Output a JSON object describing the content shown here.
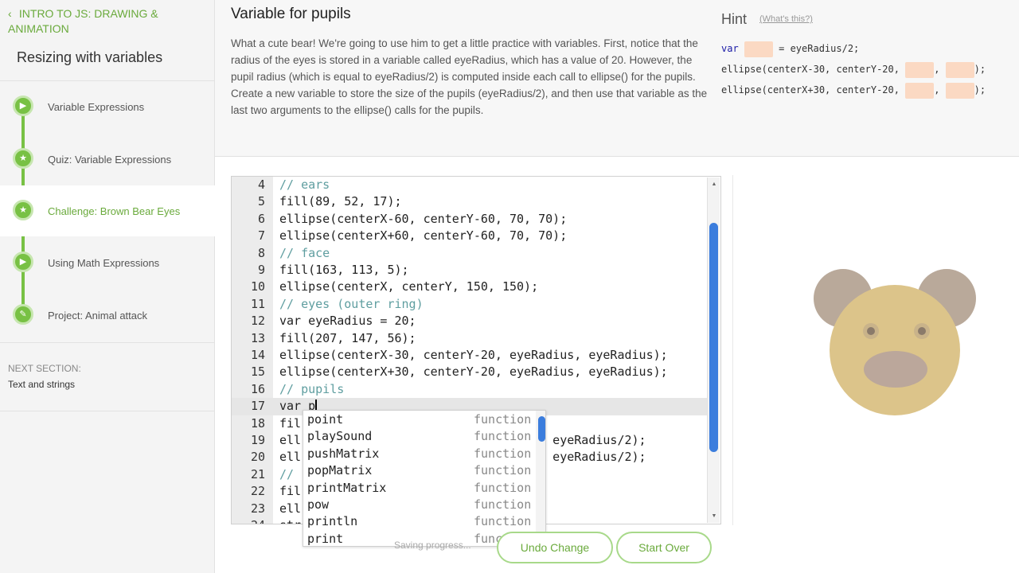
{
  "sidebar": {
    "breadcrumb": "INTRO TO JS: DRAWING & ANIMATION",
    "lesson_title": "Resizing with variables",
    "items": [
      {
        "label": "Variable Expressions",
        "icon": "play-icon"
      },
      {
        "label": "Quiz: Variable Expressions",
        "icon": "star-icon"
      },
      {
        "label": "Challenge: Brown Bear Eyes",
        "icon": "star-icon",
        "active": true
      },
      {
        "label": "Using Math Expressions",
        "icon": "play-icon"
      },
      {
        "label": "Project: Animal attack",
        "icon": "pencil-icon"
      }
    ],
    "next_label": "NEXT SECTION:",
    "next_title": "Text and strings"
  },
  "challenge": {
    "title": "Variable for pupils",
    "description": "What a cute bear! We're going to use him to get a little practice with variables. First, notice that the radius of the eyes is stored in a variable called eyeRadius, which has a value of 20. However, the pupil radius (which is equal to eyeRadius/2) is computed inside each call to ellipse() for the pupils. Create a new variable to store the size of the pupils (eyeRadius/2), and then use that variable as the last two arguments to the ellipse() calls for the pupils."
  },
  "hint": {
    "title": "Hint",
    "help_link": "(What's this?)",
    "line1_a": "var ",
    "line1_b": " = eyeRadius/2;",
    "line2_a": "ellipse(centerX-30, centerY-20, ",
    "line2_sep": ", ",
    "line2_end": ");",
    "line3_a": "ellipse(centerX+30, centerY-20, ",
    "line3_sep": ", ",
    "line3_end": ");"
  },
  "editor": {
    "lines": [
      {
        "n": "4",
        "text": "// ears"
      },
      {
        "n": "5",
        "text": "fill(89, 52, 17);"
      },
      {
        "n": "6",
        "text": "ellipse(centerX-60, centerY-60, 70, 70);"
      },
      {
        "n": "7",
        "text": "ellipse(centerX+60, centerY-60, 70, 70);"
      },
      {
        "n": "8",
        "text": "// face"
      },
      {
        "n": "9",
        "text": "fill(163, 113, 5);"
      },
      {
        "n": "10",
        "text": "ellipse(centerX, centerY, 150, 150);"
      },
      {
        "n": "11",
        "text": "// eyes (outer ring)"
      },
      {
        "n": "12",
        "text": "var eyeRadius = 20;"
      },
      {
        "n": "13",
        "text": "fill(207, 147, 56);"
      },
      {
        "n": "14",
        "text": "ellipse(centerX-30, centerY-20, eyeRadius, eyeRadius);"
      },
      {
        "n": "15",
        "text": "ellipse(centerX+30, centerY-20, eyeRadius, eyeRadius);"
      },
      {
        "n": "16",
        "text": "// pupils"
      },
      {
        "n": "17",
        "text": "var p",
        "current": true
      },
      {
        "n": "18",
        "text": "fil"
      },
      {
        "n": "19",
        "text": "ell                           dius/2, eyeRadius/2);"
      },
      {
        "n": "20",
        "text": "ell                           dius/2, eyeRadius/2);"
      },
      {
        "n": "21",
        "text": "// "
      },
      {
        "n": "22",
        "text": "fil"
      },
      {
        "n": "23",
        "text": "ell"
      },
      {
        "n": "24",
        "text": "str"
      }
    ]
  },
  "autocomplete": {
    "items": [
      {
        "name": "point",
        "type": "function"
      },
      {
        "name": "playSound",
        "type": "function"
      },
      {
        "name": "pushMatrix",
        "type": "function"
      },
      {
        "name": "popMatrix",
        "type": "function"
      },
      {
        "name": "printMatrix",
        "type": "function"
      },
      {
        "name": "pow",
        "type": "function"
      },
      {
        "name": "println",
        "type": "function"
      },
      {
        "name": "print",
        "type": "function"
      }
    ]
  },
  "controls": {
    "saving": "Saving progress...",
    "undo": "Undo Change",
    "start_over": "Start Over"
  },
  "colors": {
    "accent_green": "#6aaa3c",
    "hint_blank": "#fbd9c3",
    "scroll_blue": "#3b7ddd",
    "bear_ears": "#b9a99a",
    "bear_face": "#dcc48a",
    "bear_eyes": "#c9b38a",
    "bear_pupils": "#8a7a6a",
    "bear_nose": "#bba79b"
  }
}
